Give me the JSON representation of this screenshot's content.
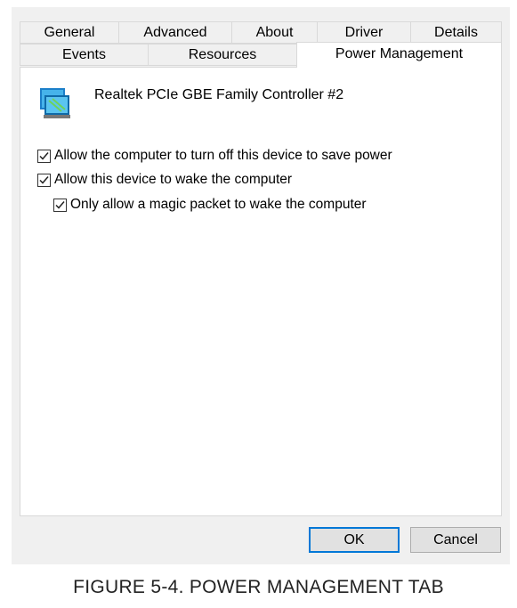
{
  "tabs": {
    "row1": [
      {
        "label": "General"
      },
      {
        "label": "Advanced"
      },
      {
        "label": "About"
      },
      {
        "label": "Driver"
      },
      {
        "label": "Details"
      }
    ],
    "row2": [
      {
        "label": "Events"
      },
      {
        "label": "Resources"
      },
      {
        "label": "Power Management",
        "selected": true
      }
    ]
  },
  "device": {
    "icon": "network-adapter-icon",
    "name": "Realtek PCIe GBE Family Controller #2"
  },
  "options": [
    {
      "label": "Allow the computer to turn off this device to save power",
      "checked": true
    },
    {
      "label": "Allow this device to wake the computer",
      "checked": true
    },
    {
      "label": "Only allow a magic packet to wake the computer",
      "checked": true
    }
  ],
  "buttons": {
    "ok_label": "OK",
    "cancel_label": "Cancel"
  },
  "caption": "FIGURE 5-4. POWER MANAGEMENT TAB",
  "colors": {
    "dialog_bg": "#f0f0f0",
    "accent": "#0078d7"
  }
}
